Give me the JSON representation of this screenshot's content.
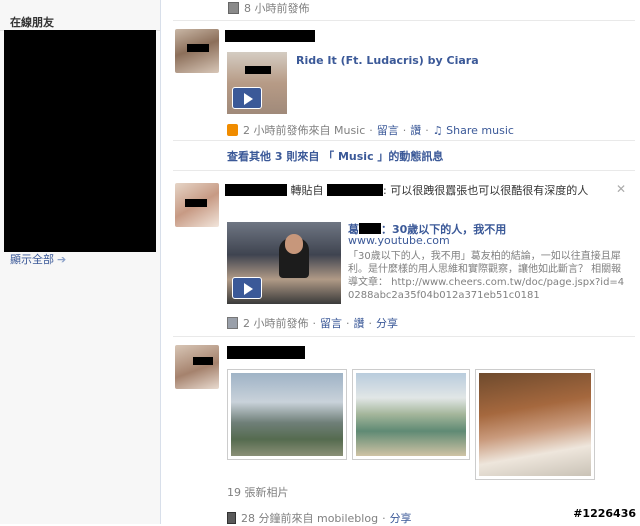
{
  "sidebar": {
    "online_friends_title": "在線朋友",
    "show_all": "顯示全部"
  },
  "feed": {
    "top_meta": "8 小時前發佈",
    "music_post": {
      "song_title": "Ride It (Ft. Ludacris) by Ciara",
      "meta_time": "2 小時前發佈來自 Music",
      "comment": "留言",
      "like": "讚",
      "share_music": "Share music",
      "more_link": "查看其他 3 則來自 「 Music 」的動態訊息"
    },
    "share_post": {
      "repost_label": "轉貼自",
      "message": ": 可以很跩很囂張也可以很酷很有深度的人",
      "link_title": "：30歲以下的人，我不用",
      "link_title_prefix": "葛",
      "link_domain": "www.youtube.com",
      "link_desc": "「30歲以下的人，我不用」葛友柏的結論，一如以往直接且犀利。是什麼樣的用人思維和實際觀察，讓他如此斷言？ 相關報導文章： http://www.cheers.com.tw/doc/page.jspx?id=40288abc2a35f04b012a371eb51c0181",
      "meta_time": "2 小時前發佈",
      "comment": "留言",
      "like": "讚",
      "share": "分享"
    },
    "photo_post": {
      "photo_count": "19 張新相片",
      "meta_time": "28 分鐘前來自 mobileblog",
      "share": "分享"
    }
  },
  "watermark": "#1226436",
  "colors": {
    "link": "#3b5998",
    "meta": "#808080",
    "redaction": "#000000"
  }
}
